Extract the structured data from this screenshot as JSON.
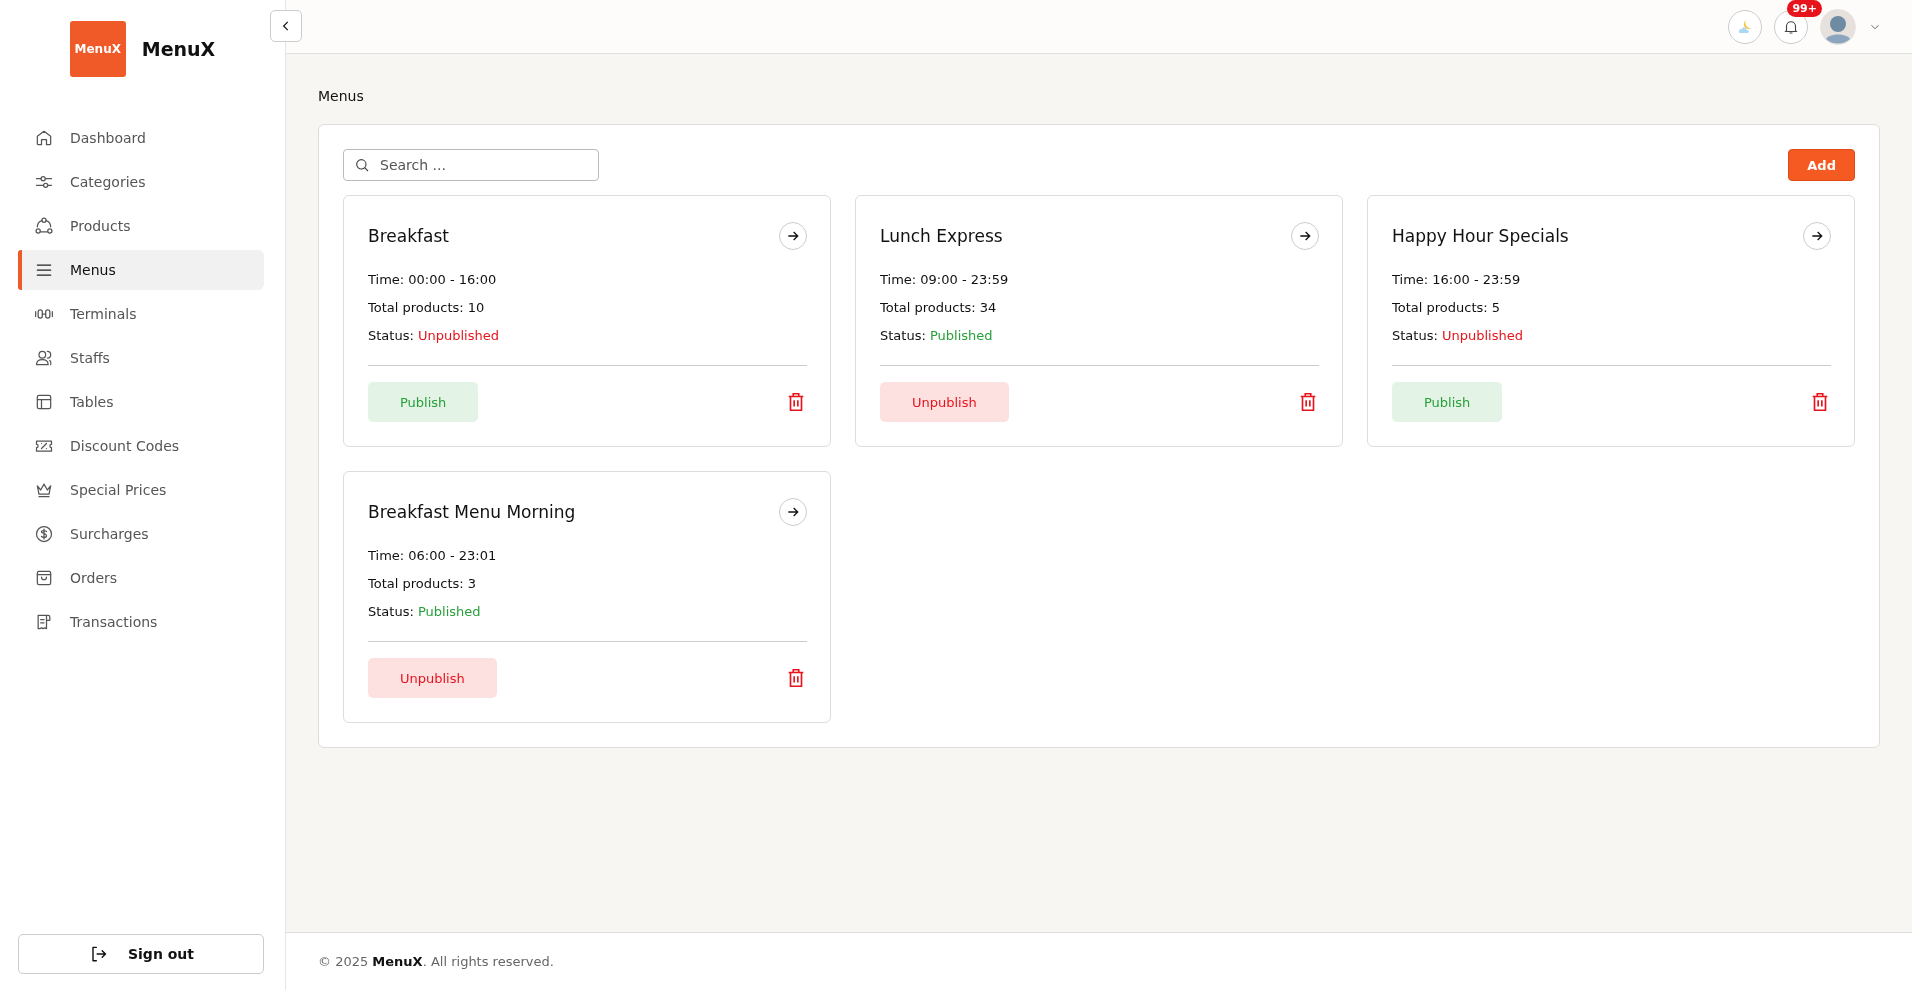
{
  "brand": {
    "logo": "MenuX",
    "name": "MenuX"
  },
  "sidebar": {
    "items": [
      {
        "label": "Dashboard",
        "selected": false
      },
      {
        "label": "Categories",
        "selected": false
      },
      {
        "label": "Products",
        "selected": false
      },
      {
        "label": "Menus",
        "selected": true
      },
      {
        "label": "Terminals",
        "selected": false
      },
      {
        "label": "Staffs",
        "selected": false
      },
      {
        "label": "Tables",
        "selected": false
      },
      {
        "label": "Discount Codes",
        "selected": false
      },
      {
        "label": "Special Prices",
        "selected": false
      },
      {
        "label": "Surcharges",
        "selected": false
      },
      {
        "label": "Orders",
        "selected": false
      },
      {
        "label": "Transactions",
        "selected": false
      }
    ],
    "sign_out": "Sign out"
  },
  "header": {
    "notification_count": "99+"
  },
  "breadcrumb": "Menus",
  "search": {
    "placeholder": "Search ..."
  },
  "add_button": "Add",
  "menus": [
    {
      "name": "Breakfast",
      "time": "Time: 00:00 - 16:00",
      "total": "Total products: 10",
      "status_label": "Status:",
      "status": "Unpublished",
      "published": false,
      "action": "Publish"
    },
    {
      "name": "Lunch Express",
      "time": "Time: 09:00 - 23:59",
      "total": "Total products: 34",
      "status_label": "Status:",
      "status": "Published",
      "published": true,
      "action": "Unpublish"
    },
    {
      "name": "Happy Hour Specials",
      "time": "Time: 16:00 - 23:59",
      "total": "Total products: 5",
      "status_label": "Status:",
      "status": "Unpublished",
      "published": false,
      "action": "Publish"
    },
    {
      "name": "Breakfast Menu Morning",
      "time": "Time: 06:00 - 23:01",
      "total": "Total products: 3",
      "status_label": "Status:",
      "status": "Published",
      "published": true,
      "action": "Unpublish"
    }
  ],
  "footer": "© 2025 **MenuX**. All rights reserved."
}
